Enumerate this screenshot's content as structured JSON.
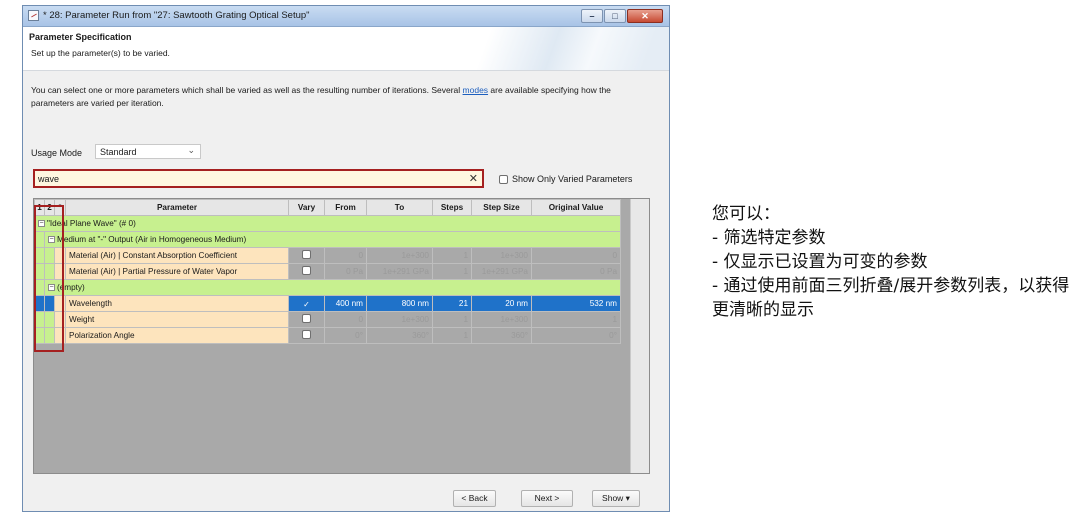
{
  "window": {
    "title": "* 28: Parameter Run from \"27: Sawtooth Grating Optical Setup\"",
    "buttons": {
      "minimize": "–",
      "maximize": "□",
      "close": "✕"
    }
  },
  "header": {
    "title": "Parameter Specification",
    "subtitle": "Set up the parameter(s) to be varied."
  },
  "intro": {
    "text_before": "You can select one or more parameters which shall be varied as well as the resulting number of iterations. Several ",
    "link": "modes",
    "text_after": " are available specifying how the parameters are varied per iteration."
  },
  "usage": {
    "label": "Usage Mode",
    "value": "Standard"
  },
  "filter": {
    "value": "wave",
    "clear": "✕",
    "show_only_label": "Show Only Varied Parameters"
  },
  "grid": {
    "headers": [
      "1",
      "2",
      "*",
      "Parameter",
      "Vary",
      "From",
      "To",
      "Steps",
      "Step Size",
      "Original Value"
    ],
    "groups": [
      {
        "label": "\"Ideal Plane Wave\" (# 0)"
      },
      {
        "label": "Medium at \"-\" Output (Air in Homogeneous Medium)"
      },
      {
        "label": "(empty)"
      }
    ],
    "rows": [
      {
        "name": "Material (Air) | Constant Absorption Coefficient",
        "from": "0",
        "to": "1e+300",
        "steps": "1",
        "step_size": "1e+300",
        "original": "0"
      },
      {
        "name": "Material (Air) | Partial Pressure of Water Vapor",
        "from": "0 Pa",
        "to": "1e+291 GPa",
        "steps": "1",
        "step_size": "1e+291 GPa",
        "original": "0 Pa"
      },
      {
        "name": "Wavelength",
        "vary": "✓",
        "from": "400 nm",
        "to": "800 nm",
        "steps": "21",
        "step_size": "20 nm",
        "original": "532 nm"
      },
      {
        "name": "Weight",
        "from": "0",
        "to": "1e+300",
        "steps": "1",
        "step_size": "1e+300",
        "original": "1"
      },
      {
        "name": "Polarization Angle",
        "from": "0°",
        "to": "360°",
        "steps": "1",
        "step_size": "360°",
        "original": "0°"
      }
    ]
  },
  "footer": {
    "back": "< Back",
    "next": "Next >",
    "show": "Show ▾"
  },
  "annotation": {
    "lines": [
      "您可以：",
      "- 筛选特定参数",
      "- 仅显示已设置为可变的参数",
      "- 通过使用前面三列折叠/展开参数列表，以获得更清晰的显示"
    ]
  }
}
